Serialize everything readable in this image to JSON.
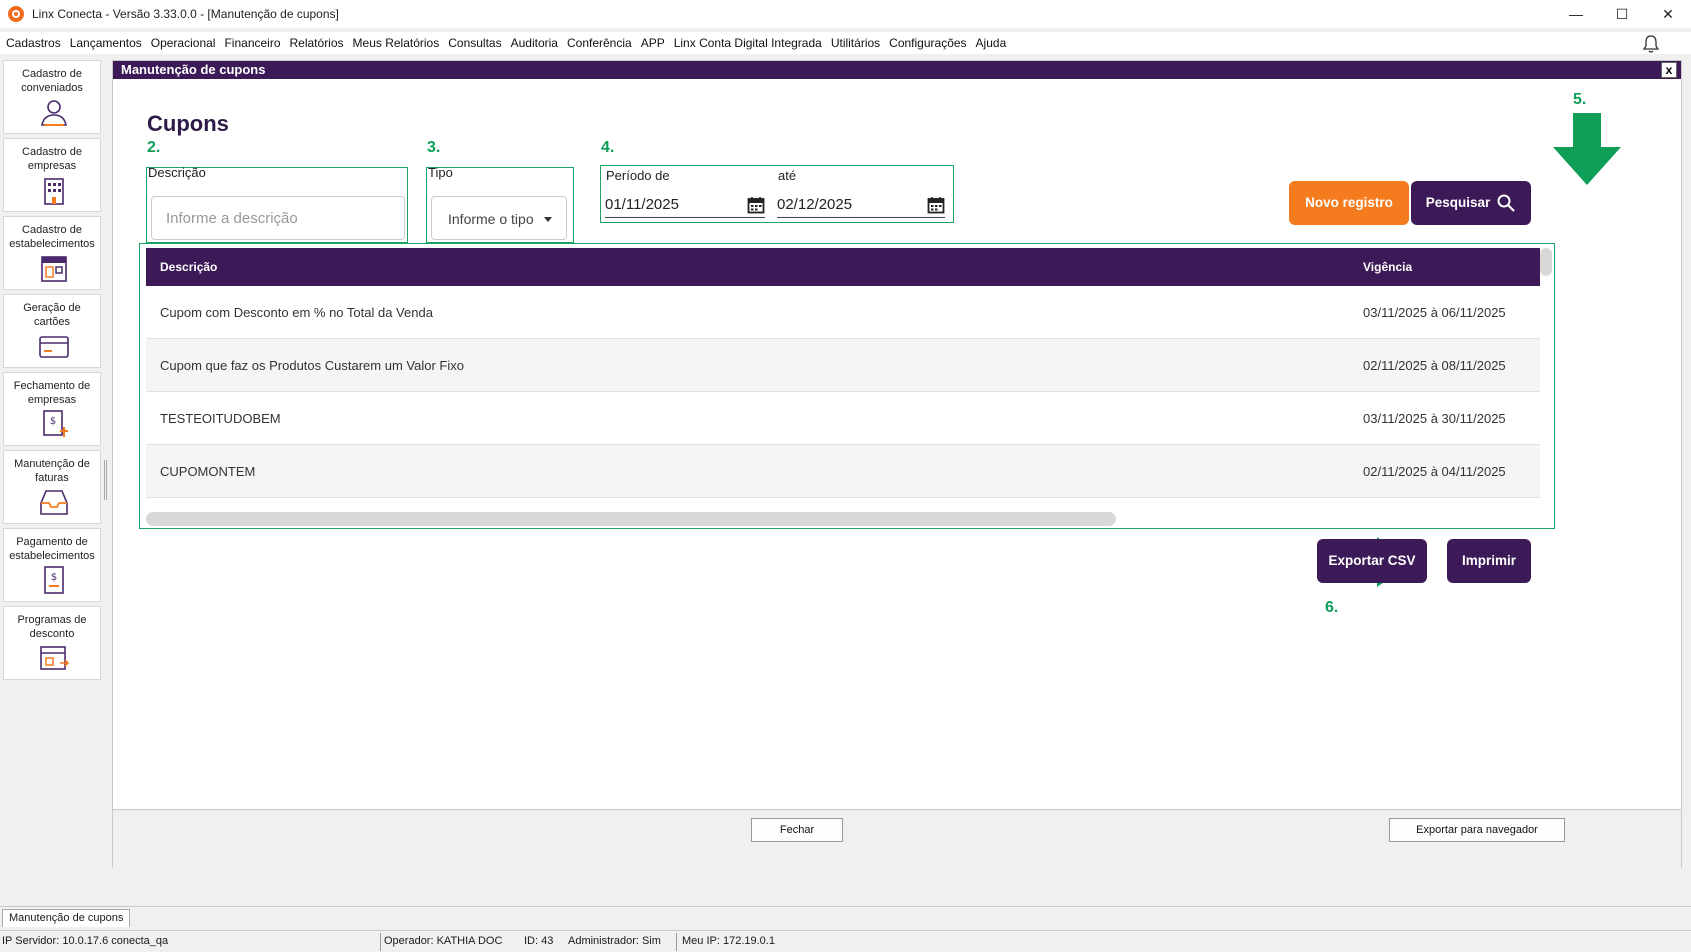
{
  "window": {
    "title": "Linx Conecta - Versão 3.33.0.0 - [Manutenção de cupons]",
    "minimize": "—",
    "maximize": "☐",
    "close": "✕"
  },
  "menu": [
    "Cadastros",
    "Lançamentos",
    "Operacional",
    "Financeiro",
    "Relatórios",
    "Meus Relatórios",
    "Consultas",
    "Auditoria",
    "Conferência",
    "APP",
    "Linx Conta Digital Integrada",
    "Utilitários",
    "Configurações",
    "Ajuda"
  ],
  "sidebar": [
    {
      "label": "Cadastro de conveniados",
      "icon": "user-icon"
    },
    {
      "label": "Cadastro de empresas",
      "icon": "building-icon"
    },
    {
      "label": "Cadastro de estabelecimentos",
      "icon": "store-icon"
    },
    {
      "label": "Geração de cartões",
      "icon": "card-icon"
    },
    {
      "label": "Fechamento de empresas",
      "icon": "invoice-close-icon"
    },
    {
      "label": "Manutenção de faturas",
      "icon": "inbox-icon"
    },
    {
      "label": "Pagamento de estabelecimentos",
      "icon": "payment-icon"
    },
    {
      "label": "Programas de desconto",
      "icon": "discount-icon"
    }
  ],
  "panel": {
    "header": "Manutenção de cupons",
    "close": "x",
    "title": "Cupons"
  },
  "steps": {
    "descricao": "2.",
    "tipo": "3.",
    "periodo": "4.",
    "pesquisar": "5.",
    "exportar": "6."
  },
  "filters": {
    "descricao_label": "Descrição",
    "descricao_placeholder": "Informe a descrição",
    "tipo_label": "Tipo",
    "tipo_placeholder": "Informe o tipo",
    "periodo_label": "Período de",
    "ate_label": "até",
    "date_from": "01/11/2025",
    "date_to": "02/12/2025"
  },
  "buttons": {
    "novo": "Novo registro",
    "pesquisar": "Pesquisar",
    "exportar_csv": "Exportar CSV",
    "imprimir": "Imprimir",
    "fechar": "Fechar",
    "exportar_navegador": "Exportar para navegador"
  },
  "table": {
    "columns": [
      "Descrição",
      "Vigência"
    ],
    "rows": [
      {
        "descricao": "Cupom com Desconto em % no Total da Venda",
        "vigencia": "03/11/2025 à 06/11/2025"
      },
      {
        "descricao": "Cupom que faz os Produtos Custarem um Valor Fixo",
        "vigencia": "02/11/2025 à 08/11/2025"
      },
      {
        "descricao": "TESTEOITUDOBEM",
        "vigencia": "03/11/2025 à 30/11/2025"
      },
      {
        "descricao": "CUPOMONTEM",
        "vigencia": "02/11/2025 à 04/11/2025"
      }
    ]
  },
  "tab": "Manutenção de cupons",
  "status": {
    "server": "IP Servidor: 10.0.17.6 conecta_qa",
    "operator": "Operador: KATHIA DOC",
    "id": "ID: 43",
    "admin": "Administrador: Sim",
    "ip": "Meu IP: 172.19.0.1"
  },
  "colors": {
    "brand_purple": "#3b1a57",
    "accent_orange": "#f57b1f",
    "annotation_green": "#1aa464"
  }
}
